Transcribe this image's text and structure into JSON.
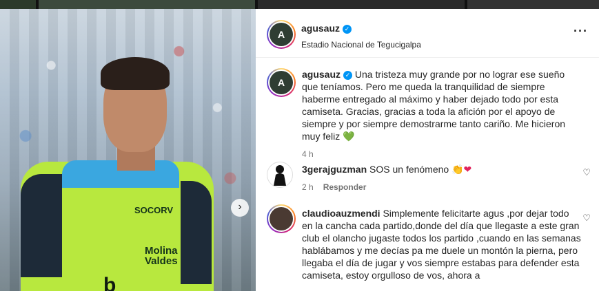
{
  "photo": {
    "next_icon": "chevron-right-icon",
    "next_glyph": "›"
  },
  "sponsors": {
    "s1": "SOCORV",
    "s2": "Molina",
    "s2b": "Valdes",
    "s3": "b"
  },
  "header": {
    "username": "agusauz",
    "location": "Estadio Nacional de Tegucigalpa",
    "avatar_letter": "A",
    "more_glyph": "···"
  },
  "caption": {
    "username": "agusauz",
    "text": "Una tristeza muy grande por no lograr ese sueño que teníamos. Pero me queda la tranquilidad de siempre haberme entregado al máximo y haber dejado todo por esta camiseta. Gracias, gracias a toda la afición por el apoyo de siempre y por siempre demostrarme tanto cariño. Me hicieron muy feliz",
    "emoji": "💚",
    "time": "4 h"
  },
  "comments": [
    {
      "username": "3gerajguzman",
      "text": "SOS un fenómeno",
      "emoji": "👏❤",
      "time": "2 h",
      "reply": "Responder"
    },
    {
      "username": "claudioauzmendi",
      "text": "Simplemente felicitarte agus ,por dejar todo en la cancha cada partido,donde del día que llegaste a este gran club el olancho jugaste todos los partido ,cuando en las semanas hablábamos y me decías pa me duele un montón la pierna, pero llegaba el día de jugar y vos siempre estabas para defender esta camiseta, estoy orgulloso de vos, ahora a"
    }
  ],
  "colors": {
    "accent": "#0095f6",
    "text": "#262626",
    "muted": "#737373"
  }
}
